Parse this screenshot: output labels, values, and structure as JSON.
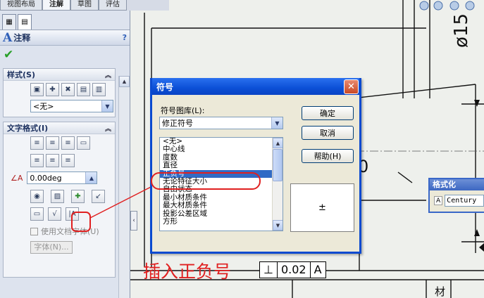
{
  "top_tabs": [
    "视图布局",
    "注解",
    "草图",
    "评估"
  ],
  "panel": {
    "title": "注释",
    "help": "?",
    "style_group": {
      "title": "样式(S)",
      "combo_value": "<无>"
    },
    "text_format_group": {
      "title": "文字格式(I)",
      "angle_value": "0.00deg",
      "use_doc_font": "使用文档字体(U)",
      "font_button": "字体(N)..."
    }
  },
  "dialog": {
    "title": "符号",
    "library_label": "符号图库(L):",
    "library_value": "修正符号",
    "symbols": [
      "<无>",
      "中心线",
      "度数",
      "直径",
      "正负号",
      "无论特征大小",
      "自由状态",
      "最小材质条件",
      "最大材质条件",
      "投影公差区域",
      "方形"
    ],
    "selected_index": 4,
    "buttons": {
      "ok": "确定",
      "cancel": "取消",
      "help": "帮助(H)"
    },
    "preview_symbol": "±"
  },
  "format_panel": {
    "title": "格式化",
    "font": "Century"
  },
  "drawing": {
    "dimension_text": "ø15",
    "tolerance_frame": [
      "⊥",
      "0.02",
      "A"
    ],
    "partial_zero": "0",
    "table_text": "材"
  },
  "caption": "插入正负号",
  "colors": {
    "accent": "#0a4ad0",
    "highlight": "#316ac5",
    "annotation_red": "#e02020"
  }
}
